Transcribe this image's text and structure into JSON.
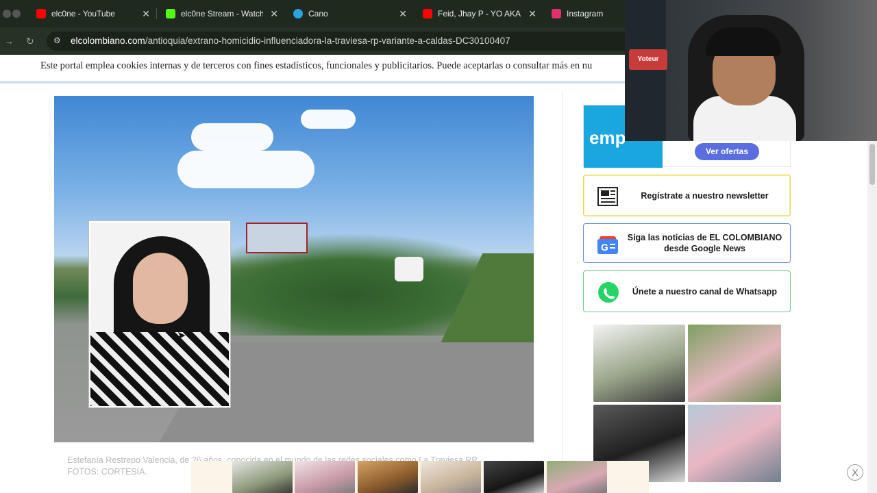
{
  "browser": {
    "tabs": [
      {
        "label": "elc0ne - YouTube",
        "icon": "youtube-icon",
        "color": "#ff0000"
      },
      {
        "label": "elc0ne Stream - Watch",
        "icon": "kick-icon",
        "color": "#53fc18"
      },
      {
        "label": "Cano",
        "icon": "telegram-icon",
        "color": "#2aa3e0"
      },
      {
        "label": "Feid, Jhay P - YO AKA",
        "icon": "youtube-icon",
        "color": "#ff0000"
      },
      {
        "label": "Instagram",
        "icon": "instagram-icon",
        "color": "#e1306c"
      }
    ],
    "url_host": "elcolombiano.com",
    "url_path": "/antioquia/extrano-homicidio-influenciadora-la-traviesa-rp-variante-a-caldas-DC30100407"
  },
  "cookie_banner": {
    "text": "Este portal emplea cookies internas y de terceros con fines estadísticos, funcionales y publicitarios. Puede aceptarlas o consultar más en nu"
  },
  "article": {
    "caption_line1": "Estefanía Restrepo Valencia, de 26 años, conocida en el mundo de las redes sociales como La Traviesa RP.",
    "caption_line2": "FOTOS: CORTESÍA."
  },
  "sidebar": {
    "emp_ad": {
      "logo_text": "emp",
      "cta": "Ver ofertas"
    },
    "promos": [
      {
        "label": "Regístrate a nuestro newsletter",
        "icon": "newspaper-icon"
      },
      {
        "label": "Siga las noticias de EL COLOMBIANO desde Google News",
        "icon": "google-news-icon"
      },
      {
        "label": "Únete a nuestro canal de Whatsapp",
        "icon": "whatsapp-icon"
      }
    ]
  },
  "webcam": {
    "sign": "Yoteur"
  },
  "bottom_ad": {
    "close": "X"
  }
}
